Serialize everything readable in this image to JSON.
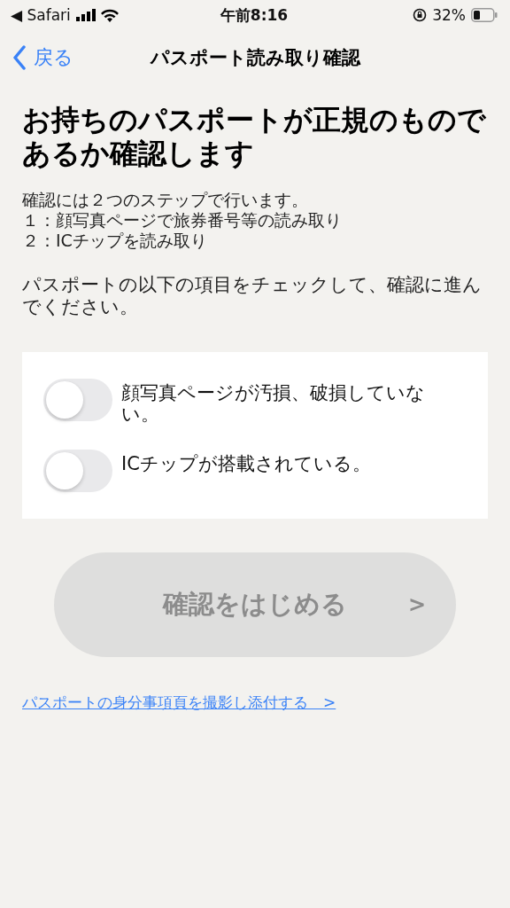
{
  "status_bar": {
    "back_app": "◀ Safari",
    "time": "午前8:16",
    "battery": "32%"
  },
  "nav": {
    "back": "戻る",
    "title": "パスポート読み取り確認"
  },
  "heading": "お持ちのパスポートが正規のものであるか確認します",
  "intro": [
    "確認には２つのステップで行います。",
    "１：顔写真ページで旅券番号等の読み取り",
    "２：ICチップを読み取り"
  ],
  "instruction": "パスポートの以下の項目をチェックして、確認に進んでください。",
  "checks": [
    {
      "label": "顔写真ページが汚損、破損していない。",
      "on": false
    },
    {
      "label": "ICチップが搭載されている。",
      "on": false
    }
  ],
  "start_button": {
    "label": "確認をはじめる",
    "chevron": ">",
    "disabled": true
  },
  "link": "パスポートの身分事項頁を撮影し添付する　>"
}
